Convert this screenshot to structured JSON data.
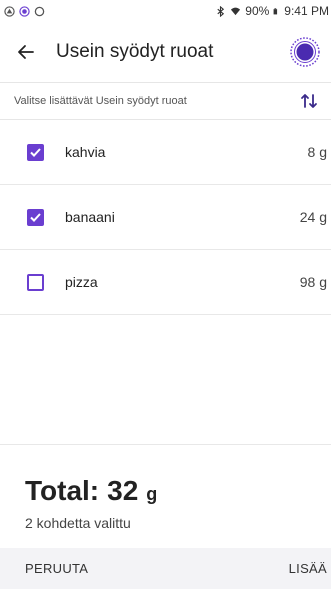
{
  "status_bar": {
    "battery": "90%",
    "time": "9:41 PM",
    "icons": [
      "pod-status-icon",
      "circle-status-icon",
      "ring-status-icon",
      "bluetooth-icon",
      "wifi-icon",
      "battery-icon"
    ]
  },
  "app_bar": {
    "title": "Usein syödyt ruoat",
    "back_icon": "arrow-left-icon",
    "pod_icon": "pod-icon"
  },
  "subheader": {
    "label": "Valitse lisättävät Usein syödyt ruoat",
    "sort_icon": "sort-arrows-icon"
  },
  "foods": [
    {
      "name": "kahvia",
      "amount": "8 g",
      "checked": true
    },
    {
      "name": "banaani",
      "amount": "24 g",
      "checked": true
    },
    {
      "name": "pizza",
      "amount": "98 g",
      "checked": false
    }
  ],
  "summary": {
    "total_label": "Total:",
    "total_value": "32",
    "total_unit": "g",
    "selected_text": "2 kohdetta valittu"
  },
  "actions": {
    "cancel": "PERUUTA",
    "add": "LISÄÄ"
  },
  "colors": {
    "accent": "#6a3ed0",
    "action_bar_bg": "#f3f3f6"
  }
}
